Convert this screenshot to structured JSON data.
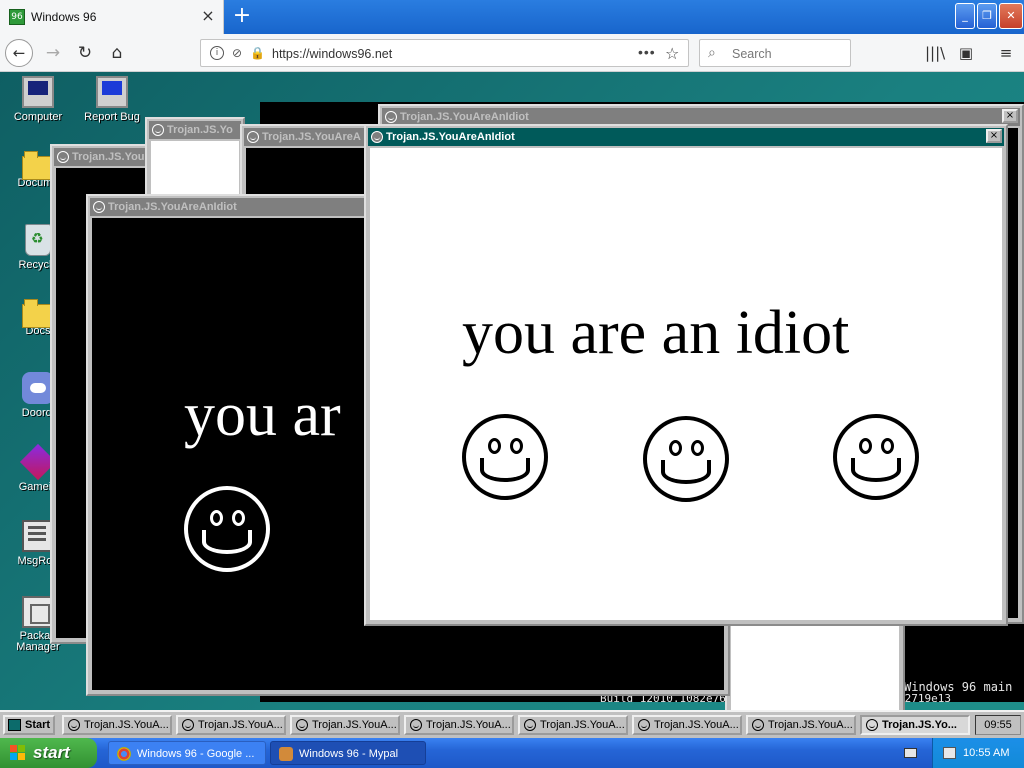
{
  "browser": {
    "tab_title": "Windows 96",
    "favicon_glyph": "96",
    "url": "https://windows96.net",
    "search_placeholder": "Search",
    "buttons": {
      "new_tab": "+",
      "back": "←",
      "forward": "→",
      "reload": "↻",
      "home": "⌂",
      "more": "•••",
      "bookmark_star": "☆",
      "close_tab": "×",
      "library": "|||\\",
      "sidebar": "▣",
      "menu": "≡",
      "minimize": "_",
      "restore": "❐",
      "close_window": "✕"
    }
  },
  "desktop": {
    "icons": [
      {
        "label": "Computer",
        "icon": "computer-icon"
      },
      {
        "label": "Report Bug",
        "icon": "report-bug-icon"
      },
      {
        "label": "Docume",
        "icon": "folder-icon"
      },
      {
        "label": "Recycle",
        "icon": "recycle-bin-icon"
      },
      {
        "label": "Docs",
        "icon": "folder-icon"
      },
      {
        "label": "Doordi",
        "icon": "discord-icon"
      },
      {
        "label": "Gamein",
        "icon": "game-icon"
      },
      {
        "label": "MsgRoo",
        "icon": "message-room-icon"
      },
      {
        "label": "Packag Manager",
        "icon": "package-manager-icon"
      }
    ],
    "background_text": {
      "line1": "Windows 96 main",
      "line2": "Build 12010.1082e7607220825-1128.16e26697fa8052719e13"
    }
  },
  "popups": {
    "title": "Trojan.JS.YouAreAnIdiot",
    "title_truncated_1": "Trojan.JS.YouAreAnIdiot",
    "title_truncated_2": "Trojan.JS.You",
    "title_truncated_3": "Trojan.JS.Yo",
    "title_truncated_4": "Trojan.JS.YouAreA",
    "message": "you are an idiot",
    "message_partial": "you ar",
    "close_glyph": "×"
  },
  "w96_taskbar": {
    "start_label": "Start",
    "tasks": [
      {
        "label": "Trojan.JS.YouA..."
      },
      {
        "label": "Trojan.JS.YouA..."
      },
      {
        "label": "Trojan.JS.YouA..."
      },
      {
        "label": "Trojan.JS.YouA..."
      },
      {
        "label": "Trojan.JS.YouA..."
      },
      {
        "label": "Trojan.JS.YouA..."
      },
      {
        "label": "Trojan.JS.YouA..."
      },
      {
        "label": "Trojan.JS.Yo..."
      }
    ],
    "clock": "09:55"
  },
  "xp_taskbar": {
    "start_label": "start",
    "tasks": [
      {
        "label": "Windows 96 - Google ..."
      },
      {
        "label": "Windows 96 - Mypal"
      }
    ],
    "clock": "10:55 AM"
  },
  "colors": {
    "firefox_titlebar": "#1865cc",
    "desktop_teal": "#1a8080",
    "active_title": "#005a5a",
    "inactive_title": "#7f7f7f",
    "xp_start_green": "#329132",
    "xp_taskbar_blue": "#2565d6"
  }
}
